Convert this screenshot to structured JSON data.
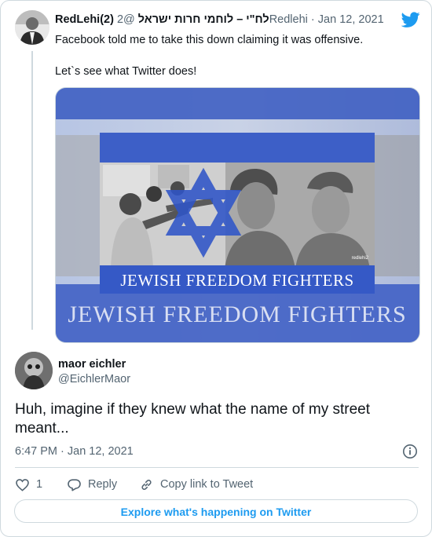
{
  "quoted_tweet": {
    "author_name": "RedLehi(2) לח\"י – לוחמי חרות ישראל",
    "author_handle": "@2Redlehi",
    "date": "Jan 12, 2021",
    "text_line_1": "Facebook told me to take this down claiming it was offensive.",
    "text_line_2": "Let`s see what Twitter does!",
    "media": {
      "caption_inner": "JEWISH FREEDOM FIGHTERS",
      "caption_outer": "JEWISH FREEDOM FIGHTERS",
      "watermark": "redlehi2"
    }
  },
  "tweet": {
    "author_name": "maor eichler",
    "author_handle": "@EichlerMaor",
    "text": "Huh, imagine if they knew what the name of my street meant...",
    "time": "6:47 PM · Jan 12, 2021"
  },
  "actions": {
    "like_count": "1",
    "reply_label": "Reply",
    "copy_link_label": "Copy link to Tweet"
  },
  "explore_label": "Explore what's happening on Twitter",
  "colors": {
    "accent": "#1d9bf0",
    "secondary_text": "#536471",
    "border": "#cfd9de",
    "flag_blue": "#3a5cc6"
  },
  "icons": [
    "twitter-bird-icon",
    "info-icon",
    "heart-icon",
    "reply-icon",
    "link-icon"
  ]
}
